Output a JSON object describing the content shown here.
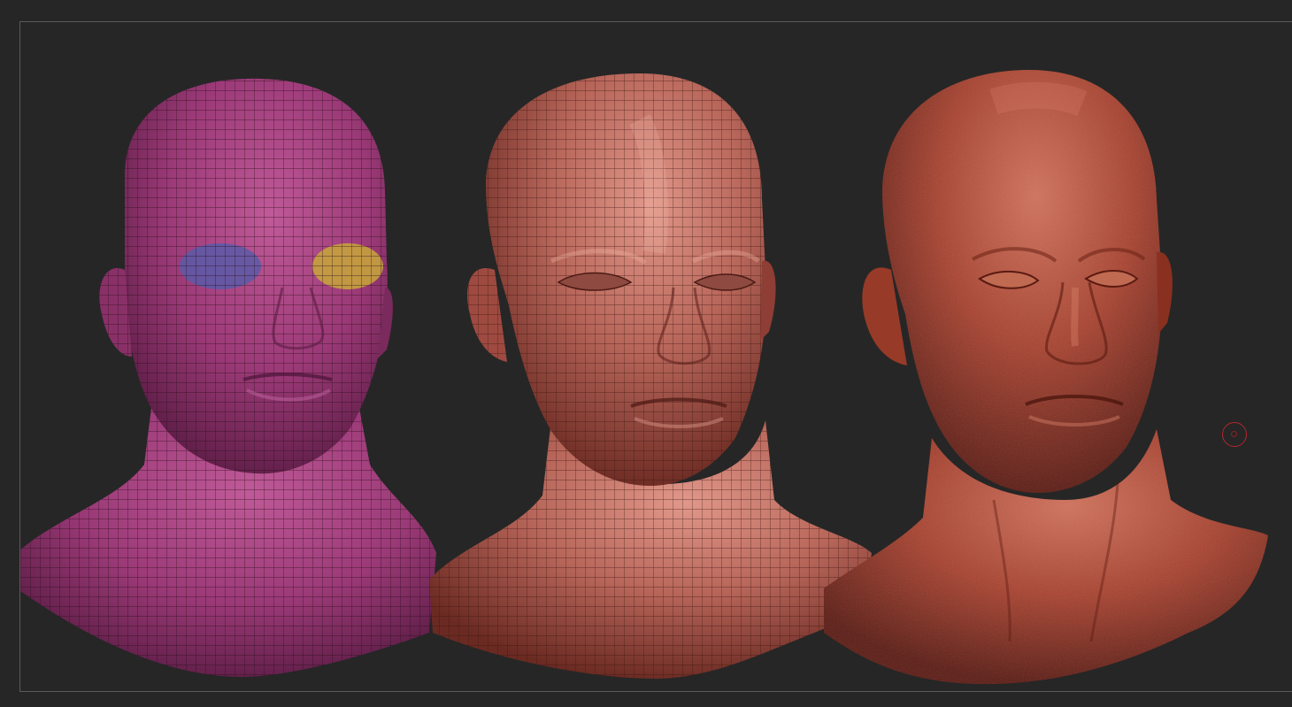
{
  "app": {
    "background_color": "#262626",
    "frame_color": "#5a5a5a"
  },
  "viewport": {
    "models": [
      {
        "id": "head-base-mesh-polygroups",
        "shading": "wireframe-with-polygroups",
        "base_color": "#9c3a78",
        "eye_polygroup_left_color": "#5a5aa8",
        "eye_polygroup_right_color": "#c8a83a"
      },
      {
        "id": "head-mid-resolution-wireframe",
        "shading": "wireframe",
        "base_color": "#b8665a"
      },
      {
        "id": "head-high-resolution-sculpt",
        "shading": "sculpted-detail",
        "base_color": "#a8412e"
      }
    ],
    "brush_cursor": {
      "icon": "brush-cursor-icon",
      "color": "#b0282c"
    }
  }
}
